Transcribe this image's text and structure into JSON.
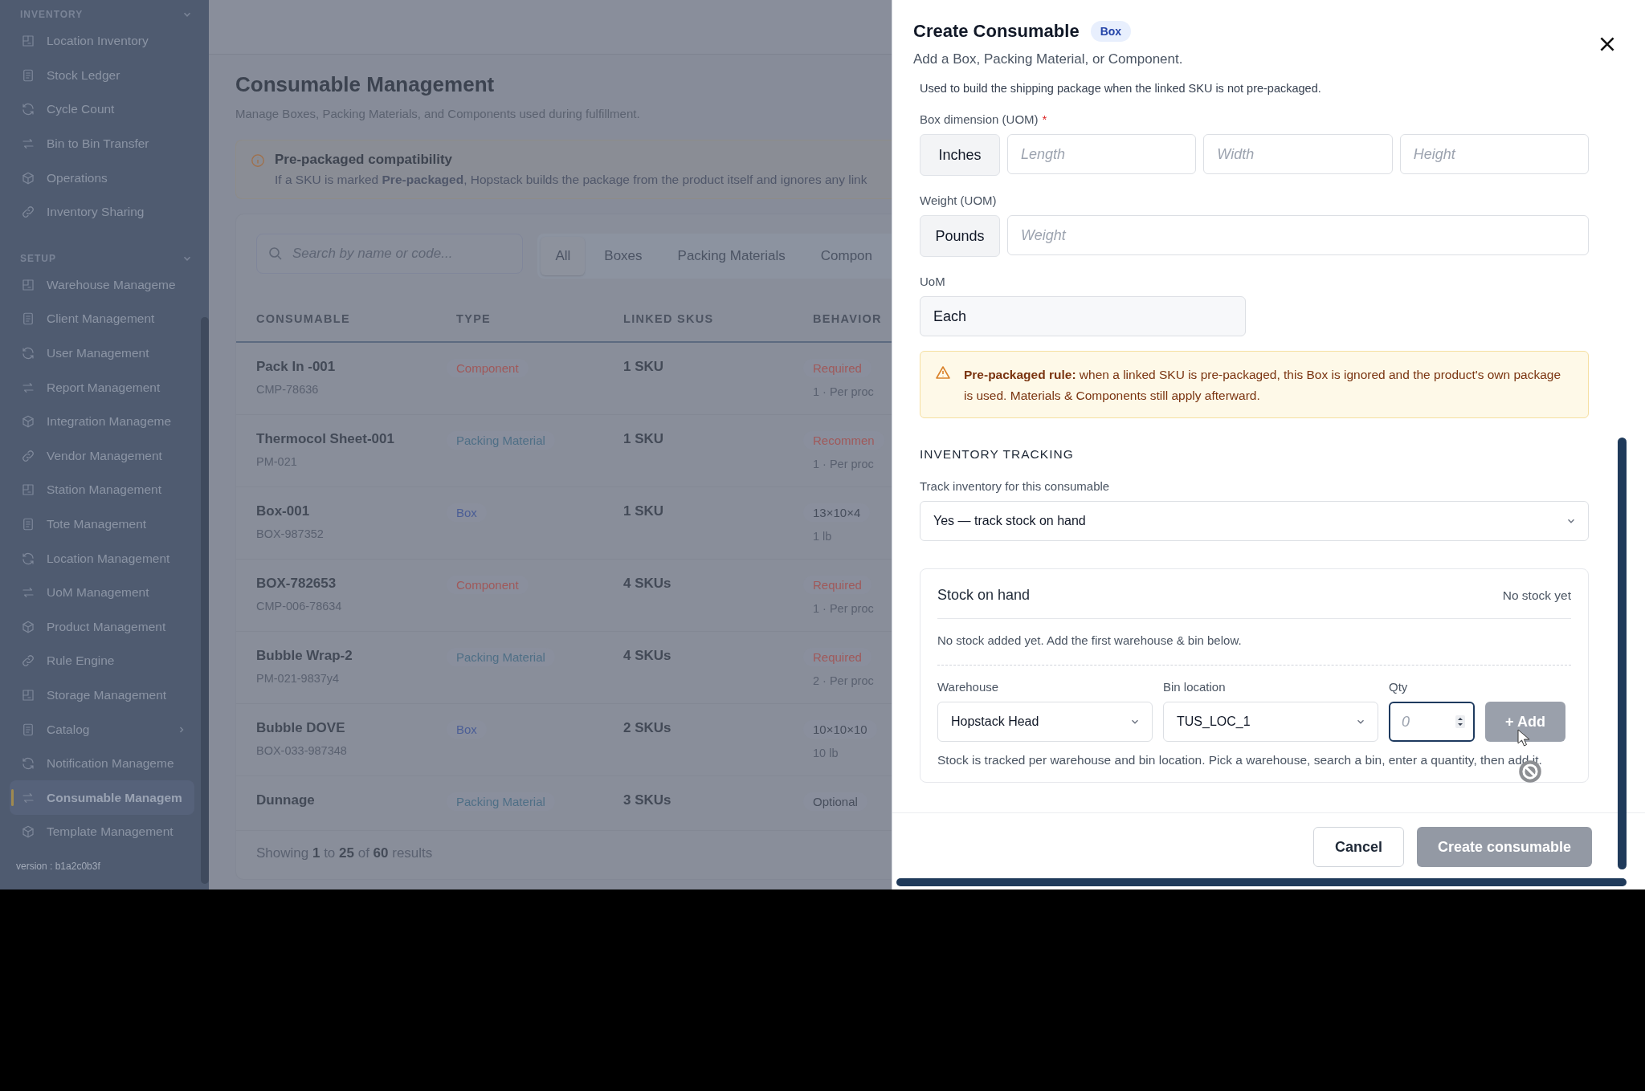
{
  "sidebar": {
    "sections": [
      {
        "label": "INVENTORY",
        "expanded": true,
        "items": [
          {
            "label": "Location Inventory",
            "selected": false,
            "kind": "link"
          },
          {
            "label": "Stock Ledger",
            "selected": false,
            "kind": "link"
          },
          {
            "label": "Cycle Count",
            "selected": false,
            "kind": "link"
          },
          {
            "label": "Bin to Bin Transfer",
            "selected": false,
            "kind": "link"
          },
          {
            "label": "Operations",
            "selected": false,
            "kind": "link"
          },
          {
            "label": "Inventory Sharing",
            "selected": false,
            "kind": "link"
          }
        ]
      },
      {
        "label": "SETUP",
        "expanded": true,
        "items": [
          {
            "label": "Warehouse Manageme",
            "selected": false,
            "kind": "link"
          },
          {
            "label": "Client Management",
            "selected": false,
            "kind": "link"
          },
          {
            "label": "User Management",
            "selected": false,
            "kind": "link"
          },
          {
            "label": "Report Management",
            "selected": false,
            "kind": "link"
          },
          {
            "label": "Integration Manageme",
            "selected": false,
            "kind": "link"
          },
          {
            "label": "Vendor Management",
            "selected": false,
            "kind": "link"
          },
          {
            "label": "Station Management",
            "selected": false,
            "kind": "link"
          },
          {
            "label": "Tote Management",
            "selected": false,
            "kind": "link"
          },
          {
            "label": "Location Management",
            "selected": false,
            "kind": "link"
          },
          {
            "label": "UoM Management",
            "selected": false,
            "kind": "link"
          },
          {
            "label": "Product Management",
            "selected": false,
            "kind": "link"
          },
          {
            "label": "Rule Engine",
            "selected": false,
            "kind": "link"
          },
          {
            "label": "Storage Management",
            "selected": false,
            "kind": "link"
          },
          {
            "label": "Catalog",
            "selected": false,
            "kind": "group"
          },
          {
            "label": "Notification Manageme",
            "selected": false,
            "kind": "link"
          },
          {
            "label": "Consumable Managem",
            "selected": true,
            "kind": "link"
          },
          {
            "label": "Template Management",
            "selected": false,
            "kind": "link"
          }
        ]
      }
    ],
    "version": "version : b1a2c0b3f"
  },
  "page": {
    "title": "Consumable Management",
    "subtitle": "Manage Boxes, Packing Materials, and Components used during fulfillment.",
    "notice": {
      "title": "Pre-packaged compatibility",
      "text": "If a SKU is marked **Pre-packaged**, Hopstack builds the package from the product itself and ignores any link"
    },
    "search": {
      "placeholder": "Search by name or code..."
    },
    "tabs": [
      {
        "label": "All",
        "selected": true
      },
      {
        "label": "Boxes",
        "selected": false
      },
      {
        "label": "Packing Materials",
        "selected": false
      },
      {
        "label": "Compon",
        "selected": false
      }
    ],
    "table": {
      "columns": [
        "CONSUMABLE",
        "TYPE",
        "LINKED SKUS",
        "BEHAVIOR"
      ],
      "rows": [
        {
          "name": "Pack In -001",
          "code": "CMP-78636",
          "type": {
            "label": "Component",
            "kind": "component"
          },
          "linked_skus": "1 SKU",
          "behavior": {
            "label": "Required",
            "kind": "required"
          },
          "detail": "1 · Per proc"
        },
        {
          "name": "Thermocol Sheet-001",
          "code": "PM-021",
          "type": {
            "label": "Packing Material",
            "kind": "material"
          },
          "linked_skus": "1 SKU",
          "behavior": {
            "label": "Recommen",
            "kind": "recommended"
          },
          "detail": "1 · Per proc"
        },
        {
          "name": "Box-001",
          "code": "BOX-987352",
          "type": {
            "label": "Box",
            "kind": "box"
          },
          "linked_skus": "1 SKU",
          "behavior": {
            "label": "13×10×4",
            "kind": "neutral"
          },
          "detail": "1 lb"
        },
        {
          "name": "BOX-782653",
          "code": "CMP-006-78634",
          "type": {
            "label": "Component",
            "kind": "component"
          },
          "linked_skus": "4 SKUs",
          "behavior": {
            "label": "Required",
            "kind": "required"
          },
          "detail": "1 · Per proc"
        },
        {
          "name": "Bubble Wrap-2",
          "code": "PM-021-9837y4",
          "type": {
            "label": "Packing Material",
            "kind": "material"
          },
          "linked_skus": "4 SKUs",
          "behavior": {
            "label": "Required",
            "kind": "required"
          },
          "detail": "2 · Per proc"
        },
        {
          "name": "Bubble DOVE",
          "code": "BOX-033-987348",
          "type": {
            "label": "Box",
            "kind": "box"
          },
          "linked_skus": "2 SKUs",
          "behavior": {
            "label": "10×10×10",
            "kind": "neutral"
          },
          "detail": "10 lb"
        },
        {
          "name": "Dunnage",
          "type": {
            "label": "Packing Material",
            "kind": "material"
          },
          "linked_skus": "3 SKUs",
          "behavior": {
            "label": "Optional",
            "kind": "neutral"
          }
        }
      ]
    },
    "pagination": "Showing **1** to **25** of **60** results"
  },
  "drawer": {
    "title": "Create Consumable",
    "badge": "Box",
    "subtitle": "Add a Box, Packing Material, or Component.",
    "intro": "Used to build the shipping package when the linked SKU is not pre-packaged.",
    "box_dimension": {
      "label": "Box dimension (UOM)",
      "required": true,
      "required_mark": "*",
      "unit": "Inches",
      "placeholders": [
        "Length",
        "Width",
        "Height"
      ]
    },
    "weight": {
      "label": "Weight (UOM)",
      "unit": "Pounds",
      "placeholder": "Weight"
    },
    "uom": {
      "label": "UoM",
      "value": "Each"
    },
    "rule": "**Pre-packaged rule:** when a linked SKU is pre-packaged, this Box is ignored and the product's own package is used. Materials & Components still apply afterward.",
    "tracking": {
      "heading": "INVENTORY TRACKING",
      "label": "Track inventory for this consumable",
      "value": "Yes — track stock on hand"
    },
    "stock": {
      "title": "Stock on hand",
      "status": "No stock yet",
      "empty_text": "No stock added yet. Add the first warehouse & bin below.",
      "warehouse": {
        "label": "Warehouse",
        "value": "Hopstack Head"
      },
      "bin": {
        "label": "Bin location",
        "value": "TUS_LOC_1"
      },
      "qty": {
        "label": "Qty",
        "placeholder": "0"
      },
      "add_button": {
        "label": "+ Add",
        "disabled": true
      },
      "hint": "Stock is tracked per warehouse and bin location. Pick a warehouse, search a bin, enter a quantity, then add it."
    },
    "buttons": {
      "cancel": "Cancel",
      "create": {
        "label": "Create consumable",
        "disabled": true
      }
    }
  }
}
